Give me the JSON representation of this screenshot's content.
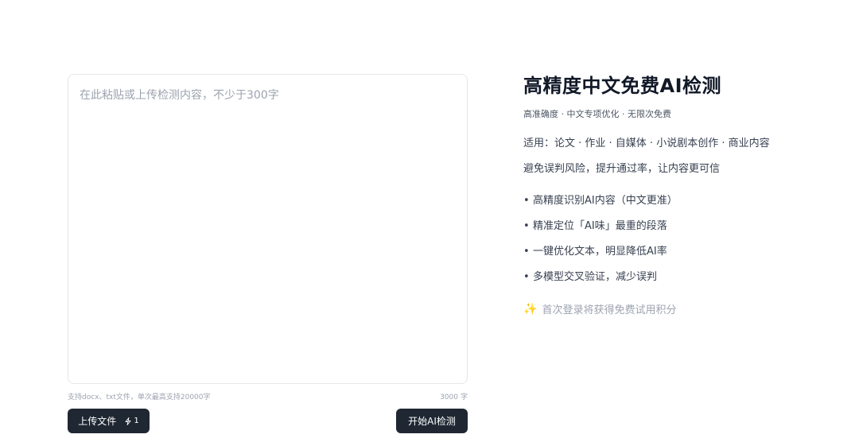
{
  "editor": {
    "placeholder": "在此粘贴或上传检测内容，不少于300字",
    "hint": "支持docx、txt文件，单次最高支持20000字",
    "count_value": "3000",
    "count_unit": "字"
  },
  "actions": {
    "upload_label": "上传文件",
    "upload_credit": "1",
    "detect_label": "开始AI检测"
  },
  "info": {
    "title": "高精度中文免费AI检测",
    "subtitle": "高准确度 · 中文专项优化 · 无限次免费",
    "usage": "适用：论文 · 作业 · 自媒体 · 小说剧本创作 · 商业内容",
    "benefit": "避免误判风险，提升通过率，让内容更可信",
    "features": [
      "高精度识别AI内容（中文更准）",
      "精准定位「AI味」最重的段落",
      "一键优化文本，明显降低AI率",
      "多模型交叉验证，减少误判"
    ],
    "bonus": "首次登录将获得免费试用积分"
  },
  "colors": {
    "button_bg": "#1f2733",
    "sparkle": "#f2b43a"
  }
}
